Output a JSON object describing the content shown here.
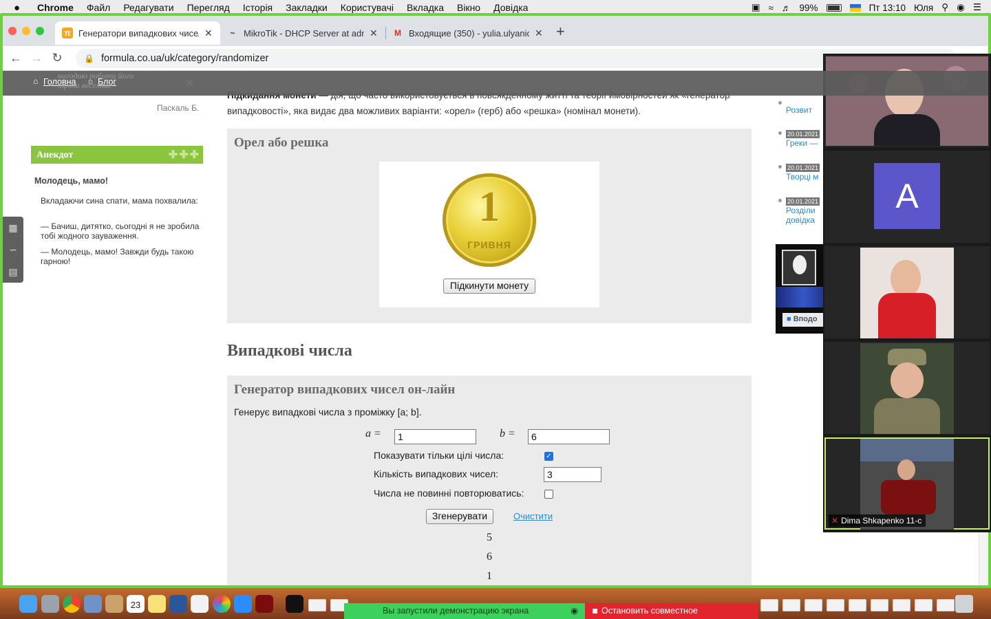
{
  "menubar": {
    "apple": "",
    "items": [
      "Chrome",
      "Файл",
      "Редагувати",
      "Перегляд",
      "Історія",
      "Закладки",
      "Користувачі",
      "Вкладка",
      "Вікно",
      "Довідка"
    ],
    "battery": "99%",
    "clock": "Пт 13:10",
    "user": "Юля"
  },
  "browser": {
    "tabs": [
      {
        "title": "Генератори випадкових чисел",
        "favicon": "π"
      },
      {
        "title": "MikroTik - DHCP Server at adm",
        "favicon": "~"
      },
      {
        "title": "Входящие (350) - yulia.ulyanic",
        "favicon": "M"
      }
    ],
    "new_tab": "+",
    "url": "formula.co.ua/uk/category/randomizer"
  },
  "site": {
    "breadcrumbs": [
      "Головна",
      "Блог"
    ],
    "faded_quote": "нагодою робити його\nтрохи веселіше",
    "quote_author": "Паскаль Б.",
    "joke": {
      "header": "Анекдот",
      "title": "Молодець, мамо!",
      "paragraphs": [
        "Вкладаючи сина спати, мама похвалила:",
        "— Бачиш, дитятко, сьогодні я не зробила тобі жодного зауваження.",
        "— Молодець, мамо! Завжди будь такою гарною!"
      ]
    },
    "intro_bold": "Підкидання монети",
    "intro_rest": " — дія, що часто використовується в повсякденному житті та теорії ймовірностей як «генератор випадковості», яка видає два можливих варіанти: «орел» (герб) або «решка» (номінал монети).",
    "coin_box": {
      "title": "Орел або решка",
      "coin_value": "1",
      "coin_word": "ГРИВНЯ",
      "button": "Підкинути монету"
    },
    "section_title": "Випадкові числа",
    "generator": {
      "title": "Генератор випадкових чисел он-лайн",
      "description": "Генерує випадкові числа з проміжку [a; b].",
      "a_label": "a =",
      "a_value": "1",
      "b_label": "b =",
      "b_value": "6",
      "integers_label": "Показувати тільки цілі числа:",
      "integers_checked": true,
      "count_label": "Кількість випадкових чисел:",
      "count_value": "3",
      "no_repeat_label": "Числа не повинні повторюватись:",
      "no_repeat_checked": false,
      "generate_button": "Згенерувати",
      "clear_link": "Очистити",
      "results": [
        "5",
        "6",
        "1"
      ]
    },
    "news": [
      {
        "date": "",
        "title": "Розвит"
      },
      {
        "date": "20.01.2021",
        "title": "Греки —"
      },
      {
        "date": "20.01.2021",
        "title": "Творці м"
      },
      {
        "date": "20.01.2021",
        "title": "Розділи довідка"
      }
    ],
    "fb_button": "Вподо"
  },
  "zoom": {
    "tiles": [
      {
        "type": "video"
      },
      {
        "type": "avatar",
        "letter": "A"
      },
      {
        "type": "video"
      },
      {
        "type": "video"
      },
      {
        "type": "video",
        "name": "Dima Shkapenko 11-c",
        "active": true
      }
    ]
  },
  "dock": {
    "share_notice": "Вы запустили демонстрацию экрана",
    "stop_share": "Остановить совместное использование",
    "calendar_day": "23"
  },
  "colors": {
    "share_frame": "#6dd03e",
    "site_green": "#8bc540",
    "link_blue": "#2a8ad1",
    "zoom_avatar": "#5b56c9"
  }
}
